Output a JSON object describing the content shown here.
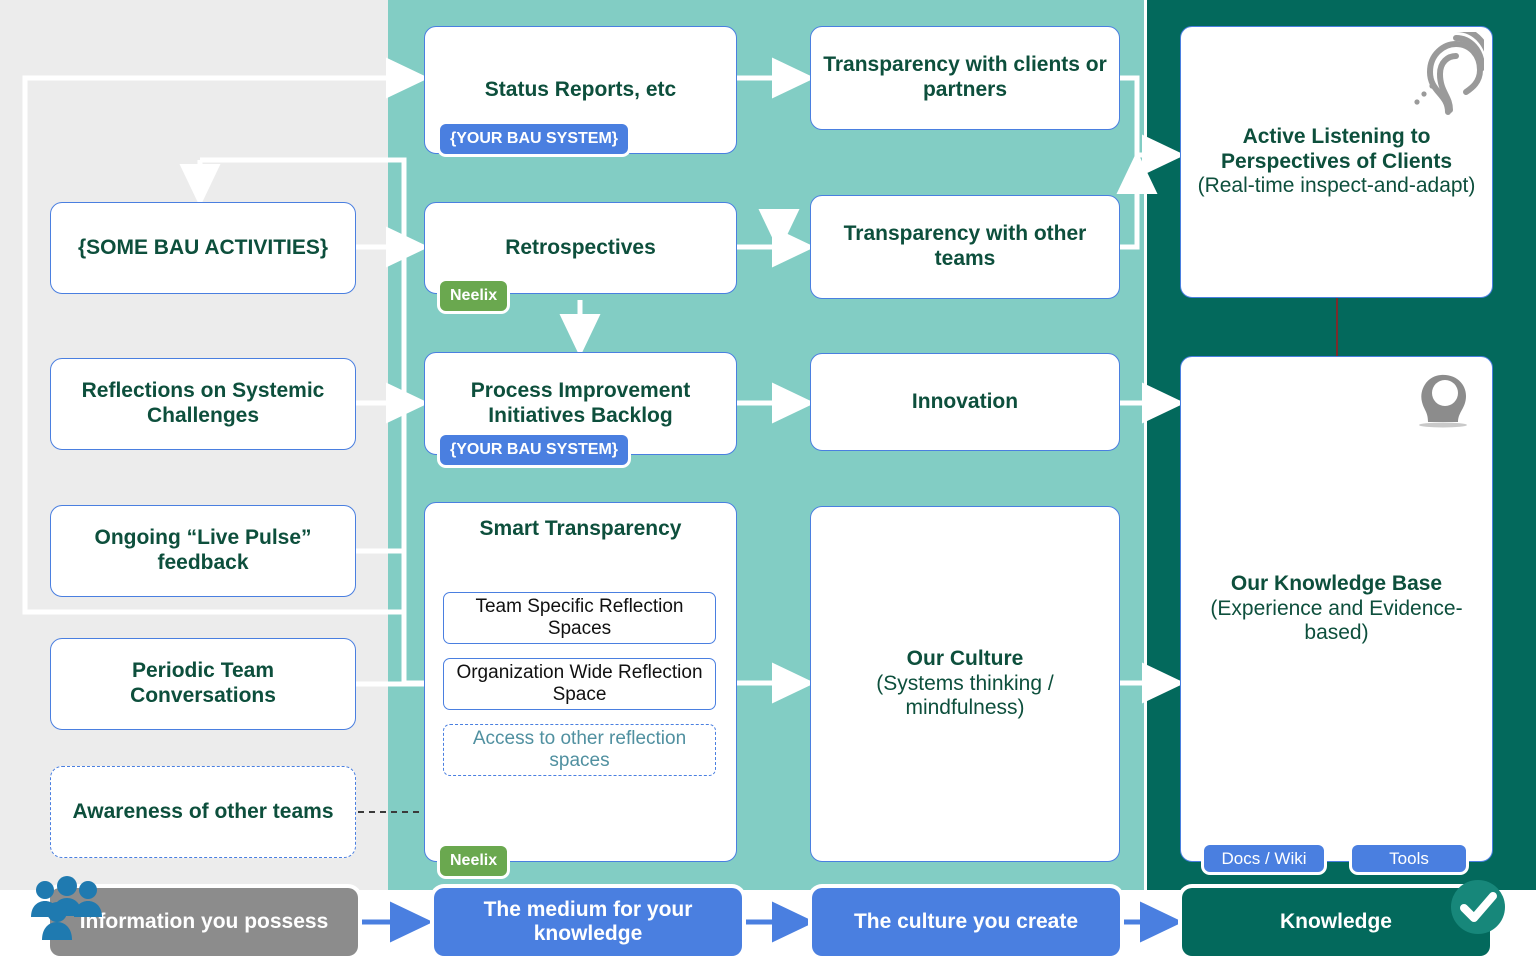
{
  "panels": {
    "left_label": "Information you possess",
    "middle_label": "The medium for your knowledge",
    "culture_label": "The culture you create",
    "knowledge_label": "Knowledge"
  },
  "colors": {
    "gray_panel": "#ececec",
    "teal_panel": "#82cdc4",
    "dark_panel": "#03695c",
    "node_border": "#4a7fe0",
    "node_text": "#0d4f3c",
    "badge_blue": "#4a7fe0",
    "badge_green": "#6aa84f",
    "strip_gray": "#8c8c8c",
    "strip_blue": "#4a7fe0",
    "arrow_white": "#ffffff",
    "arrow_blue": "#4a7fe0"
  },
  "column_inputs": [
    {
      "label": "{SOME BAU ACTIVITIES}",
      "dashed": false
    },
    {
      "label": "Reflections on Systemic Challenges",
      "dashed": false
    },
    {
      "label": "Ongoing “Live Pulse” feedback",
      "dashed": false
    },
    {
      "label": "Periodic Team Conversations",
      "dashed": false
    },
    {
      "label": "Awareness of other teams",
      "dashed": true
    }
  ],
  "column_medium": [
    {
      "label": "Status Reports, etc",
      "badge": "{YOUR BAU SYSTEM}",
      "badge_color": "blue"
    },
    {
      "label": "Retrospectives",
      "badge": "Neelix",
      "badge_color": "green"
    },
    {
      "label": "Process Improvement Initiatives Backlog",
      "badge": "{YOUR BAU SYSTEM}",
      "badge_color": "blue"
    }
  ],
  "smart_transparency": {
    "title": "Smart Transparency",
    "badge": "Neelix",
    "badge_color": "green",
    "items": [
      {
        "label": "Team Specific Reflection Spaces",
        "dashed": false
      },
      {
        "label": "Organization Wide Reflection Space",
        "dashed": false
      },
      {
        "label": "Access to other reflection spaces",
        "dashed": true
      }
    ]
  },
  "column_culture": [
    {
      "label": "Transparency with clients or partners"
    },
    {
      "label": "Transparency with other teams"
    },
    {
      "label": "Innovation"
    },
    {
      "label": "Our Culture",
      "sub": "(Systems thinking / mindfulness)"
    }
  ],
  "column_knowledge": [
    {
      "label": "Active Listening to Perspectives of Clients",
      "sub": "(Real-time inspect-and-adapt)",
      "icon": "ear-listening-icon"
    },
    {
      "label": "Our Knowledge Base",
      "sub": "(Experience and Evidence-based)",
      "icon": "head-idea-icon"
    }
  ],
  "knowledge_tags": [
    "Docs / Wiki",
    "Tools"
  ],
  "icons": {
    "people": "people-group-icon",
    "check": "check-circle-icon"
  }
}
